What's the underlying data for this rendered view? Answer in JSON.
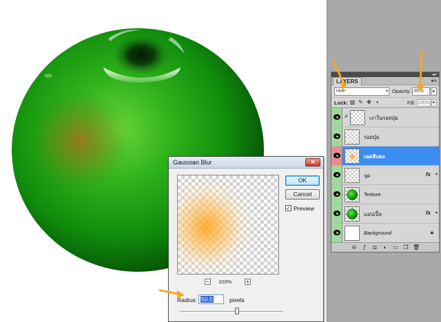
{
  "layers_panel": {
    "tab_label": "LAYERS",
    "menu_icon": "panel-menu-icon",
    "blend_mode": "Hue",
    "opacity_label": "Opacity:",
    "opacity_value": "85%",
    "lock_label": "Lock:",
    "fill_label": "Fill:",
    "fill_value": "100%",
    "layers": [
      {
        "name": "เงาในรอยบุ๋ม",
        "thumb": "transparent",
        "linked": true,
        "state": "visible"
      },
      {
        "name": "รอยบุ๋ม",
        "thumb": "transparent",
        "state": "visible"
      },
      {
        "name": "เฉดสีแดง",
        "thumb": "orange-blur",
        "state": "selected"
      },
      {
        "name": "จุด",
        "thumb": "transparent",
        "fx": "fx",
        "state": "visible"
      },
      {
        "name": "Texture",
        "thumb": "apple",
        "state": "visible"
      },
      {
        "name": "แอปเปิ้ล",
        "thumb": "apple",
        "fx": "fx",
        "state": "visible"
      },
      {
        "name": "Background",
        "thumb": "white",
        "locked": true,
        "state": "visible"
      }
    ]
  },
  "gaussian_blur": {
    "title": "Gaussian Blur",
    "ok_label": "OK",
    "cancel_label": "Cancel",
    "preview_label": "Preview",
    "preview_checked": true,
    "zoom_value": "100%",
    "zoom_minus": "−",
    "zoom_plus": "+",
    "radius_label": "Radius:",
    "radius_value": "50.0",
    "radius_unit": "pixels"
  },
  "colors": {
    "apple_green": "#0f8a0f",
    "selection_blue": "#3a8df0",
    "annotation_orange": "#f5a623"
  }
}
